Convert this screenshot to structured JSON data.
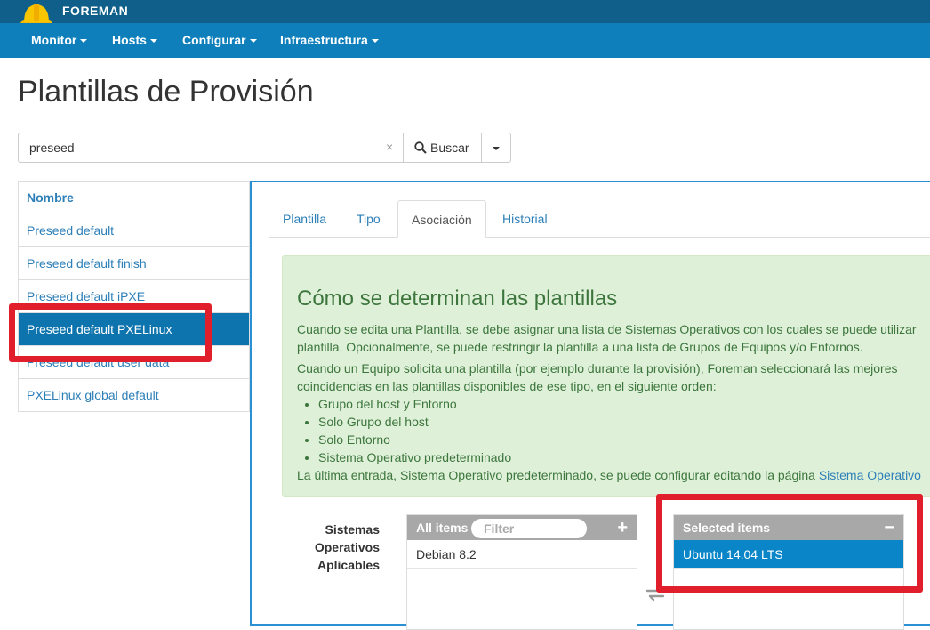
{
  "app": {
    "name": "FOREMAN"
  },
  "nav": [
    {
      "label": "Monitor"
    },
    {
      "label": "Hosts"
    },
    {
      "label": "Configurar"
    },
    {
      "label": "Infraestructura"
    }
  ],
  "page": {
    "title": "Plantillas de Provisión"
  },
  "search": {
    "value": "preseed",
    "clear": "×",
    "button": "Buscar"
  },
  "list": {
    "header": "Nombre",
    "rows": [
      "Preseed default",
      "Preseed default finish",
      "Preseed default iPXE",
      "Preseed default PXELinux",
      "Preseed default user data",
      "PXELinux global default"
    ],
    "selected_index": 3
  },
  "tabs": [
    "Plantilla",
    "Tipo",
    "Asociación",
    "Historial"
  ],
  "active_tab": "Asociación",
  "info": {
    "title": "Cómo se determinan las plantillas",
    "p1a": "Cuando se edita una Plantilla, se debe asignar una lista de Sistemas Operativos con los cuales se puede utilizar",
    "p1b": "plantilla. Opcionalmente, se puede restringir la plantilla a una lista de Grupos de Equipos y/o Entornos.",
    "p2a": "Cuando un Equipo solicita una plantilla (por ejemplo durante la provisión), Foreman seleccionará las mejores",
    "p2b": "coincidencias en las plantillas disponibles de ese tipo, en el siguiente orden:",
    "order": [
      "Grupo del host y Entorno",
      "Solo Grupo del host",
      "Solo Entorno",
      "Sistema Operativo predeterminado"
    ],
    "footer": "La última entrada, Sistema Operativo predeterminado, se puede configurar editando la página",
    "footer_link": "Sistema Operativo"
  },
  "os_assign": {
    "label_lines": [
      "Sistemas",
      "Operativos",
      "Aplicables"
    ],
    "all_items": {
      "title": "All items",
      "filter_placeholder": "Filter",
      "items": [
        "Debian 8.2"
      ]
    },
    "selected_items": {
      "title": "Selected items",
      "items": [
        "Ubuntu 14.04 LTS"
      ]
    }
  },
  "colors": {
    "topbar": "#0f5f8a",
    "navbar": "#0e7fba",
    "link": "#2d7fb8",
    "active_row": "#0e74ae",
    "alert_bg": "#dff0d8",
    "alert_text": "#3c763d",
    "annotation_red": "#e11e2b"
  },
  "icons": {
    "brand": "hard-hat-icon",
    "search": "magnifier-icon",
    "add": "plus-icon",
    "remove": "minus-icon",
    "swap": "swap-arrows-icon"
  }
}
